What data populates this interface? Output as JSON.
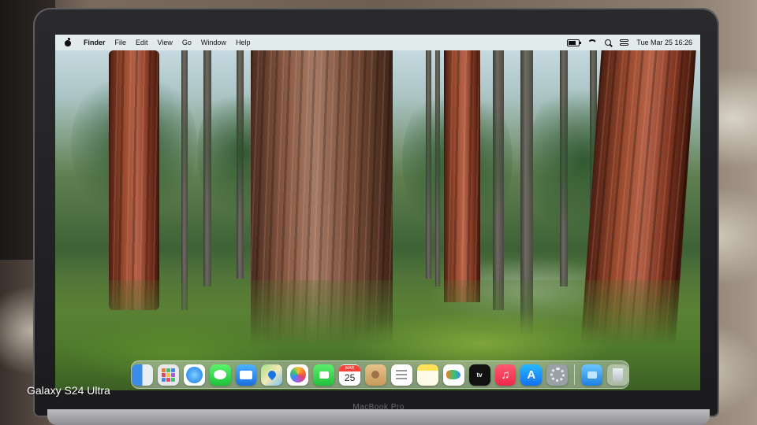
{
  "menubar": {
    "app_name": "Finder",
    "items": [
      "File",
      "Edit",
      "View",
      "Go",
      "Window",
      "Help"
    ],
    "clock": "Tue Mar 25  16:26"
  },
  "dock": {
    "apps": [
      {
        "name": "Finder",
        "icon": "finder-icon"
      },
      {
        "name": "Launchpad",
        "icon": "launchpad-icon"
      },
      {
        "name": "Safari",
        "icon": "safari-icon"
      },
      {
        "name": "Messages",
        "icon": "messages-icon"
      },
      {
        "name": "Mail",
        "icon": "mail-icon"
      },
      {
        "name": "Maps",
        "icon": "maps-icon"
      },
      {
        "name": "Photos",
        "icon": "photos-icon"
      },
      {
        "name": "FaceTime",
        "icon": "facetime-icon"
      },
      {
        "name": "Calendar",
        "icon": "calendar-icon"
      },
      {
        "name": "Contacts",
        "icon": "contacts-icon"
      },
      {
        "name": "Reminders",
        "icon": "reminders-icon"
      },
      {
        "name": "Notes",
        "icon": "notes-icon"
      },
      {
        "name": "Freeform",
        "icon": "freeform-icon"
      },
      {
        "name": "TV",
        "icon": "tv-icon"
      },
      {
        "name": "Music",
        "icon": "music-icon"
      },
      {
        "name": "App Store",
        "icon": "app-store-icon"
      },
      {
        "name": "System Settings",
        "icon": "settings-icon"
      },
      {
        "name": "Downloads",
        "icon": "downloads-folder-icon"
      },
      {
        "name": "Trash",
        "icon": "trash-icon"
      }
    ],
    "calendar_month": "MAR",
    "calendar_day": "25",
    "tv_label": "tv"
  },
  "device": {
    "model_label": "MacBook Pro",
    "watermark": "Galaxy S24 Ultra"
  },
  "colors": {
    "menubar_bg": "#ebf0ee",
    "bezel": "#1b1b1d"
  }
}
